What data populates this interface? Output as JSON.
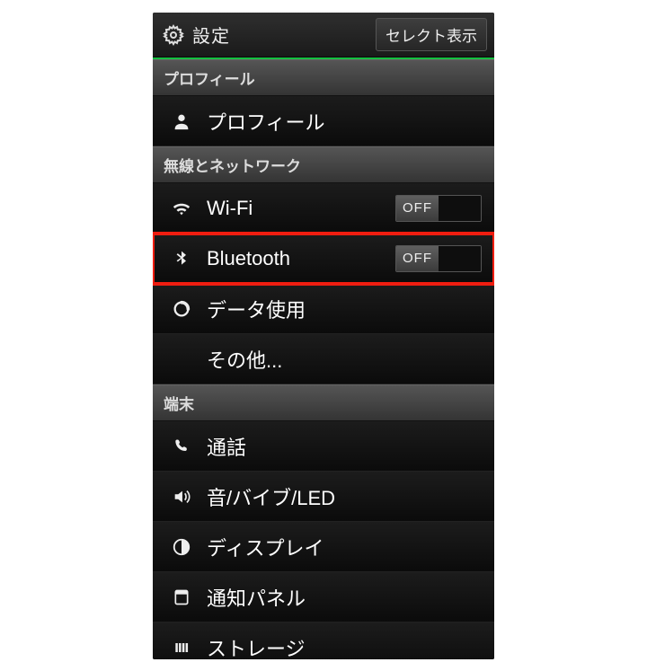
{
  "header": {
    "title": "設定",
    "select_button": "セレクト表示"
  },
  "sections": {
    "profile_header": "プロフィール",
    "wireless_header": "無線とネットワーク",
    "device_header": "端末"
  },
  "items": {
    "profile": "プロフィール",
    "wifi": "Wi-Fi",
    "bluetooth": "Bluetooth",
    "data": "データ使用",
    "more": "その他...",
    "call": "通話",
    "sound": "音/バイブ/LED",
    "display": "ディスプレイ",
    "notif": "通知パネル",
    "storage": "ストレージ"
  },
  "toggle": {
    "off": "OFF"
  }
}
